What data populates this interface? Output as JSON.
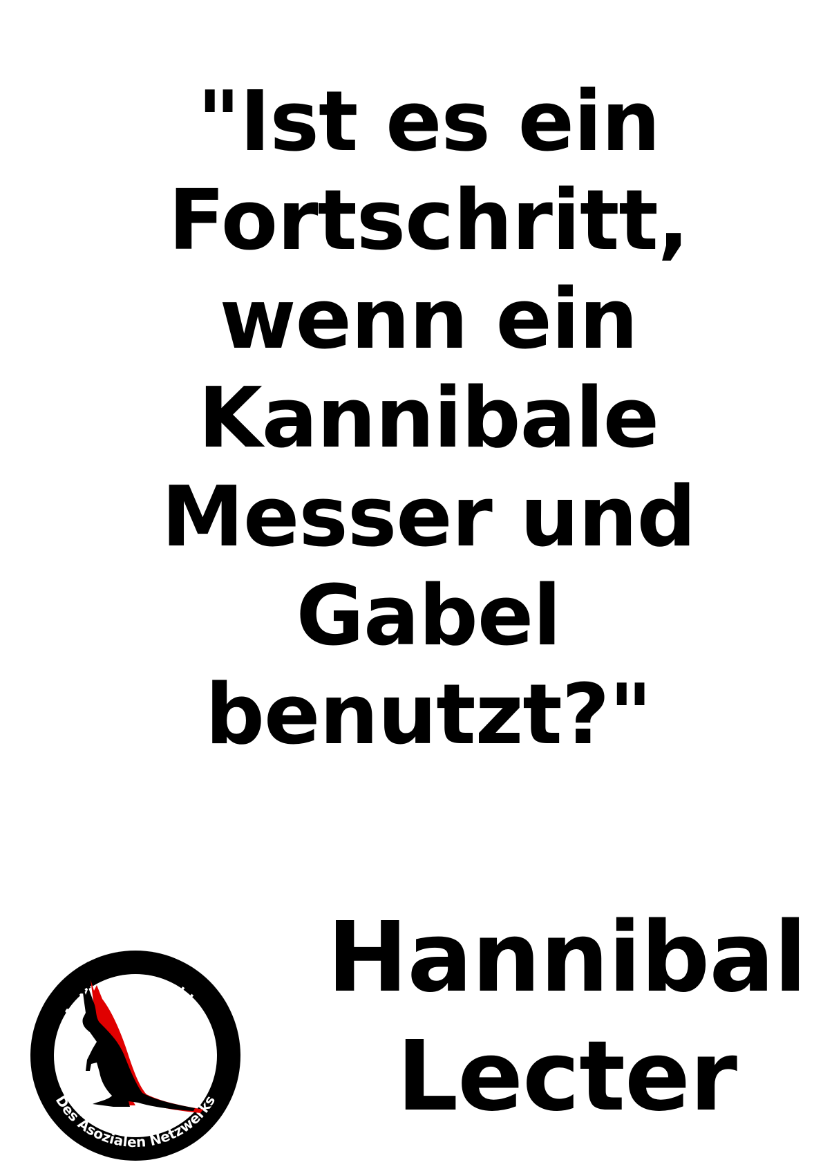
{
  "quote": {
    "lines": [
      "\"Ist es ein",
      "Fortschritt,",
      "wenn ein",
      "Kannibale",
      "Messer und",
      "Gabel",
      "benutzt?\""
    ]
  },
  "author": {
    "lines": [
      "Hannibal",
      "Lecter"
    ]
  },
  "logo": {
    "top_text": "Antiterroranschlag",
    "bottom_text": "Des Asozialen Netzwerks",
    "icon": "kangaroo-icon",
    "colors": {
      "ring": "#000000",
      "silhouette": "#000000",
      "shadow": "#e00000"
    }
  }
}
